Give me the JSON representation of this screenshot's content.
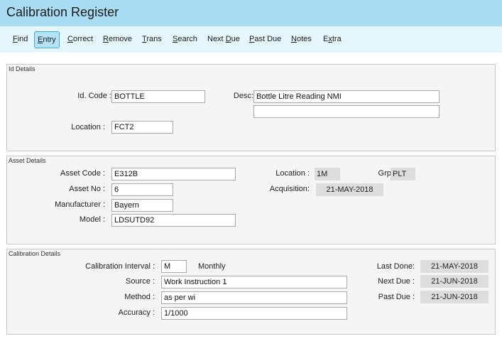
{
  "window": {
    "title": "Calibration Register"
  },
  "menu": [
    {
      "pre": "",
      "key": "F",
      "post": "ind"
    },
    {
      "pre": "",
      "key": "E",
      "post": "ntry"
    },
    {
      "pre": "",
      "key": "C",
      "post": "orrect"
    },
    {
      "pre": "",
      "key": "R",
      "post": "emove"
    },
    {
      "pre": "",
      "key": "T",
      "post": "rans"
    },
    {
      "pre": "",
      "key": "S",
      "post": "earch"
    },
    {
      "pre": "Next ",
      "key": "D",
      "post": "ue"
    },
    {
      "pre": "",
      "key": "P",
      "post": "ast Due"
    },
    {
      "pre": "",
      "key": "N",
      "post": "otes"
    },
    {
      "pre": "E",
      "key": "x",
      "post": "tra"
    }
  ],
  "id_details": {
    "section_title": "Id Details",
    "id_code_label": "Id. Code :",
    "id_code": "BOTTLE",
    "desc_label": "Desc:",
    "desc_line1": "Bottle Litre Reading NMI",
    "desc_line2": "",
    "location_label": "Location :",
    "location": "FCT2"
  },
  "asset_details": {
    "section_title": "Asset Details",
    "asset_code_label": "Asset Code :",
    "asset_code": "E312B",
    "asset_no_label": "Asset No :",
    "asset_no": "6",
    "manufacturer_label": "Manufacturer :",
    "manufacturer": "Bayern",
    "model_label": "Model :",
    "model": "LDSUTD92",
    "location_label": "Location :",
    "location": "1M",
    "grp_label": "Grp :",
    "grp": "PLT",
    "acquisition_label": "Acquisition:",
    "acquisition": "21-MAY-2018"
  },
  "calibration_details": {
    "section_title": "Calibration Details",
    "interval_label": "Calibration Interval :",
    "interval_code": "M",
    "interval_desc": "Monthly",
    "source_label": "Source :",
    "source": "Work Instruction 1",
    "method_label": "Method :",
    "method": "as per wi",
    "accuracy_label": "Accuracy :",
    "accuracy": "1/1000",
    "last_done_label": "Last Done:",
    "last_done": "21-MAY-2018",
    "next_due_label": "Next Due :",
    "next_due": "21-JUN-2018",
    "past_due_label": "Past Due :",
    "past_due": "21-JUN-2018"
  }
}
